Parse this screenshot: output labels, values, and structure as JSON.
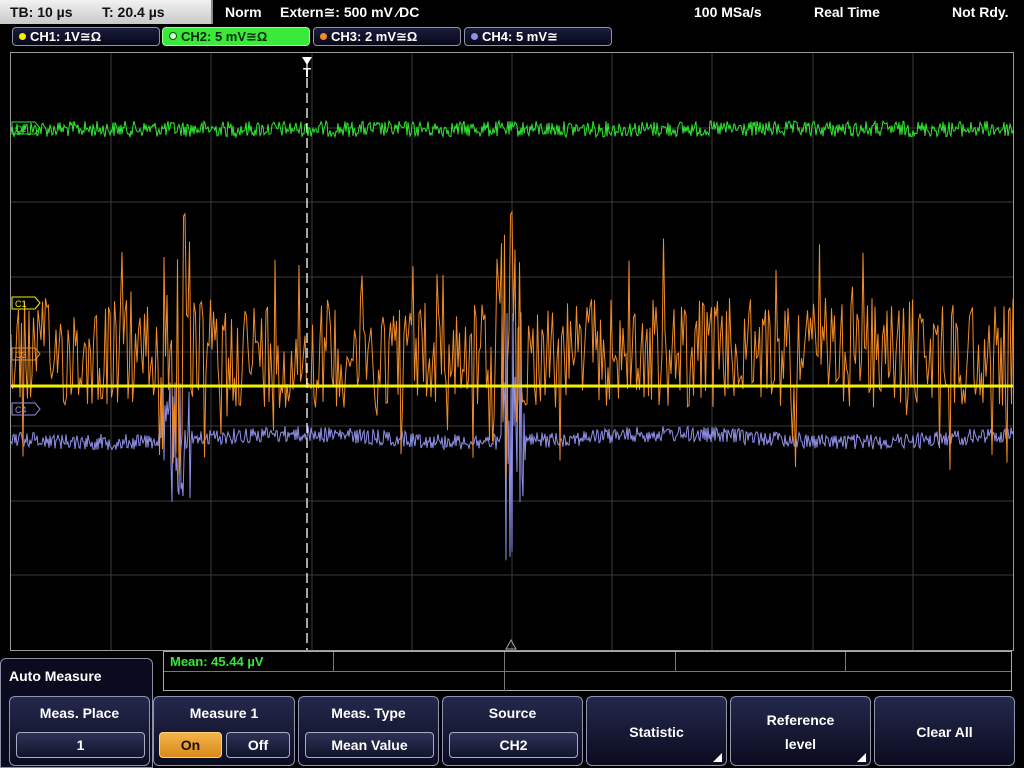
{
  "status_bar": {
    "timebase": "TB: 10 µs",
    "trigger_time": "T: 20.4 µs",
    "trigger_mode": "Norm",
    "trigger_source": "Extern≅: 500 mV ⁄DC",
    "sample_rate": "100 MSa/s",
    "acq_mode": "Real Time",
    "trigger_state": "Not Rdy."
  },
  "channels": [
    {
      "label": "CH1: 1V≅Ω",
      "color": "#f2f200",
      "active": false
    },
    {
      "label": "CH2: 5 mV≅Ω",
      "color": "#31e531",
      "active": true
    },
    {
      "label": "CH3: 2 mV≅Ω",
      "color": "#f08c2a",
      "active": false
    },
    {
      "label": "CH4: 5 mV≅",
      "color": "#8f8fe6",
      "active": false
    }
  ],
  "waveform_markers": {
    "ch1": "C1",
    "ch2": "C2",
    "ch3": "C3",
    "ch4": "C4",
    "trigger": "T"
  },
  "measurement": {
    "mean": "Mean: 45.44 µV"
  },
  "auto_measure": {
    "title": "Auto Measure"
  },
  "softkeys": {
    "meas_place": {
      "label": "Meas. Place",
      "value": "1"
    },
    "measure1": {
      "label": "Measure 1",
      "on": "On",
      "off": "Off"
    },
    "meas_type": {
      "label": "Meas. Type",
      "value": "Mean Value"
    },
    "source": {
      "label": "Source",
      "value": "CH2"
    },
    "statistic": {
      "label": "Statistic"
    },
    "reference_level": {
      "label1": "Reference",
      "label2": "level"
    },
    "clear_all": {
      "label": "Clear All"
    }
  },
  "colors": {
    "ch1": "#f2f200",
    "ch2": "#31e531",
    "ch3": "#f08c2a",
    "ch4": "#8f8fe6",
    "accent_on": "#f0a02e"
  }
}
